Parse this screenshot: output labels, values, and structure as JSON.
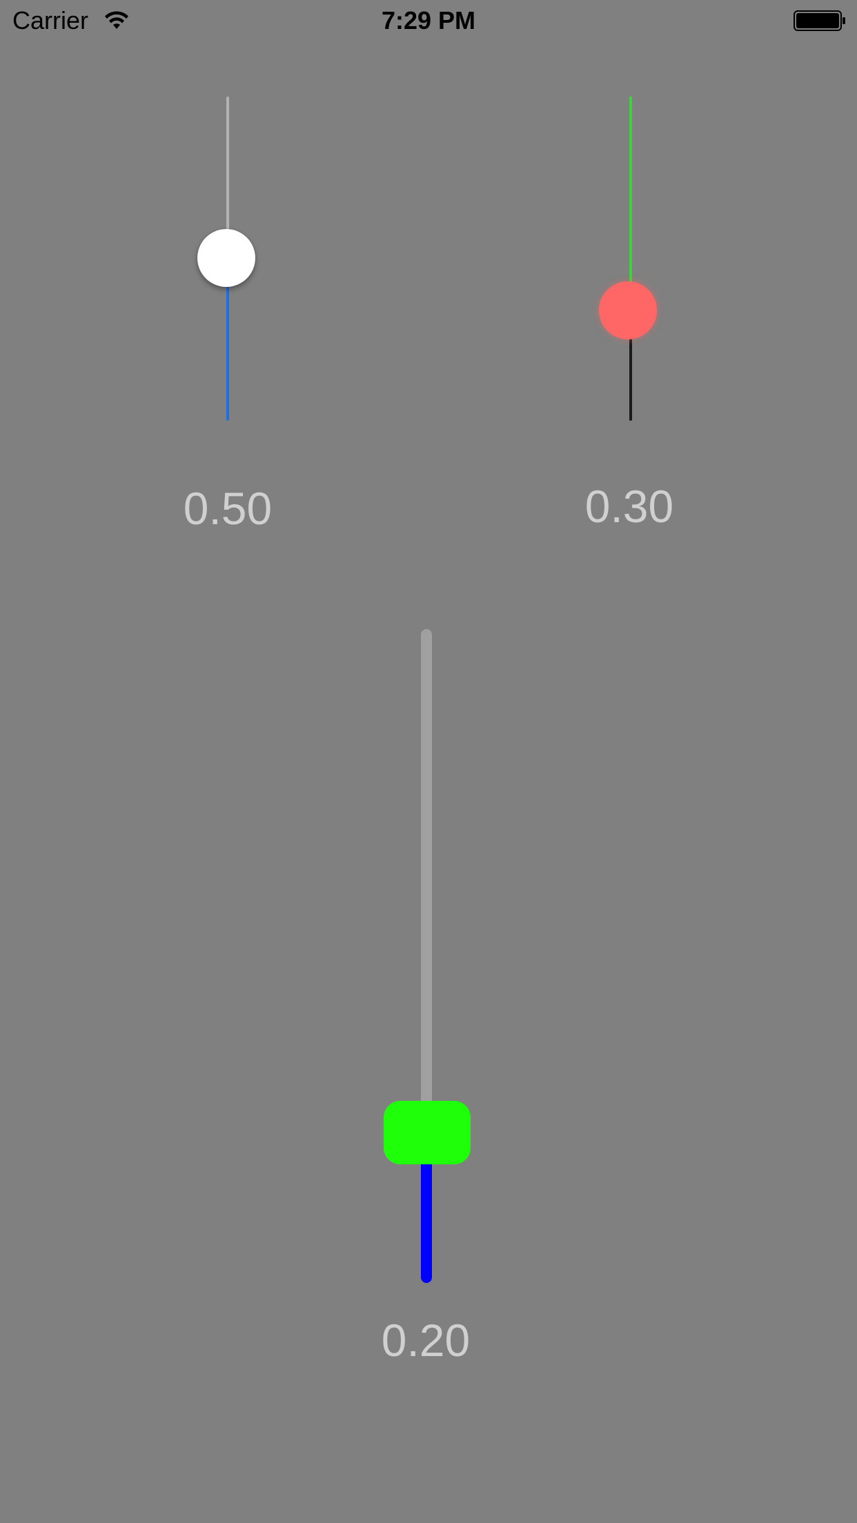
{
  "status_bar": {
    "carrier": "Carrier",
    "time": "7:29 PM",
    "wifi_icon": "wifi-icon",
    "battery_icon": "battery-icon"
  },
  "background_color": "#808080",
  "sliders": [
    {
      "name": "slider-1",
      "value": 0.5,
      "value_label": "0.50",
      "min_track_color": "#1e6fe6",
      "max_track_color": "#b3b3b3",
      "thumb_color": "#ffffff",
      "thumb_shape": "circle"
    },
    {
      "name": "slider-2",
      "value": 0.3,
      "value_label": "0.30",
      "min_track_color": "#1a1a1a",
      "max_track_color": "#3ed33a",
      "thumb_color": "#ff6666",
      "thumb_shape": "circle"
    },
    {
      "name": "slider-3",
      "value": 0.2,
      "value_label": "0.20",
      "min_track_color": "#0000ff",
      "max_track_color": "#a0a0a0",
      "thumb_color": "#1eff0a",
      "thumb_shape": "rounded-rectangle"
    }
  ]
}
